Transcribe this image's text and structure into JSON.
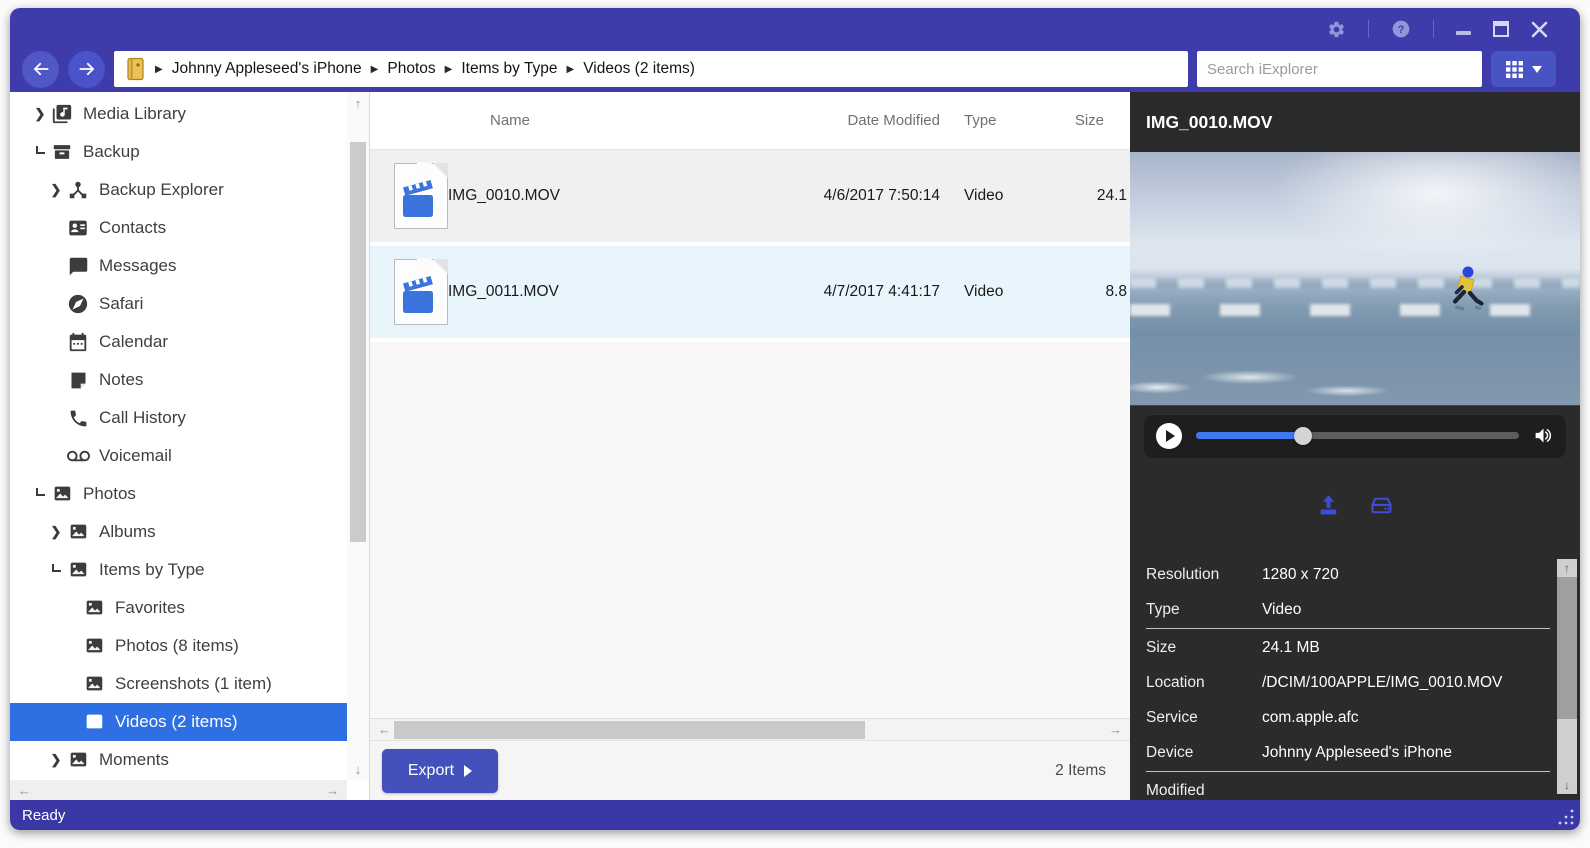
{
  "titlebar": {
    "icons": [
      "settings-icon",
      "help-icon",
      "minimize-icon",
      "maximize-icon",
      "close-icon"
    ]
  },
  "breadcrumb": {
    "root_icon": "device-folder-icon",
    "items": [
      "Johnny Appleseed's iPhone",
      "Photos",
      "Items by Type",
      "Videos (2 items)"
    ]
  },
  "search": {
    "placeholder": "Search iExplorer"
  },
  "view_button": {
    "icon": "grid-view-icon"
  },
  "sidebar": {
    "items": [
      {
        "label": "Media Library",
        "icon": "media-library-icon",
        "level": 0,
        "expander": "collapsed"
      },
      {
        "label": "Backup",
        "icon": "backup-box-icon",
        "level": 0,
        "expander": "expanded"
      },
      {
        "label": "Backup Explorer",
        "icon": "backup-explorer-icon",
        "level": 1,
        "expander": "collapsed"
      },
      {
        "label": "Contacts",
        "icon": "contacts-icon",
        "level": 1
      },
      {
        "label": "Messages",
        "icon": "messages-icon",
        "level": 1
      },
      {
        "label": "Safari",
        "icon": "safari-icon",
        "level": 1
      },
      {
        "label": "Calendar",
        "icon": "calendar-icon",
        "level": 1
      },
      {
        "label": "Notes",
        "icon": "notes-icon",
        "level": 1
      },
      {
        "label": "Call History",
        "icon": "phone-icon",
        "level": 1
      },
      {
        "label": "Voicemail",
        "icon": "voicemail-icon",
        "level": 1
      },
      {
        "label": "Photos",
        "icon": "photo-icon",
        "level": 0,
        "expander": "expanded"
      },
      {
        "label": "Albums",
        "icon": "photo-icon",
        "level": 1,
        "expander": "collapsed"
      },
      {
        "label": "Items by Type",
        "icon": "photo-icon",
        "level": 1,
        "expander": "expanded"
      },
      {
        "label": "Favorites",
        "icon": "photo-icon",
        "level": 2
      },
      {
        "label": "Photos (8 items)",
        "icon": "photo-icon",
        "level": 2
      },
      {
        "label": "Screenshots (1 item)",
        "icon": "photo-icon",
        "level": 2
      },
      {
        "label": "Videos (2 items)",
        "icon": "photo-icon",
        "level": 2,
        "selected": true
      },
      {
        "label": "Moments",
        "icon": "photo-icon",
        "level": 1,
        "expander": "collapsed"
      }
    ]
  },
  "filelist": {
    "columns": {
      "name": "Name",
      "date": "Date Modified",
      "type": "Type",
      "size": "Size"
    },
    "rows": [
      {
        "name": "IMG_0010.MOV",
        "date": "4/6/2017 7:50:14",
        "type": "Video",
        "size": "24.1"
      },
      {
        "name": "IMG_0011.MOV",
        "date": "4/7/2017 4:41:17",
        "type": "Video",
        "size": "8.8"
      }
    ],
    "items_count": "2 Items"
  },
  "export": {
    "label": "Export"
  },
  "preview": {
    "title": "IMG_0010.MOV",
    "meta": [
      {
        "label": "Resolution",
        "value": "1280 x 720"
      },
      {
        "label": "Type",
        "value": "Video"
      },
      {
        "label": "Size",
        "value": "24.1 MB"
      },
      {
        "label": "Location",
        "value": "/DCIM/100APPLE/IMG_0010.MOV"
      },
      {
        "label": "Service",
        "value": "com.apple.afc"
      },
      {
        "label": "Device",
        "value": "Johnny Appleseed's iPhone"
      },
      {
        "label": "Modified",
        "value": ""
      }
    ]
  },
  "status": {
    "text": "Ready"
  },
  "colors": {
    "titlebar": "#3e3caa",
    "statusbar": "#3a37a6",
    "selection_blue": "#2e6fe3",
    "accent_button": "#4450bb",
    "panel_dark": "#2b2b2b",
    "progress_blue": "#3e78ef",
    "file_icon_blue": "#3b74dd",
    "panel_action_icons": "#3c4ed8"
  }
}
